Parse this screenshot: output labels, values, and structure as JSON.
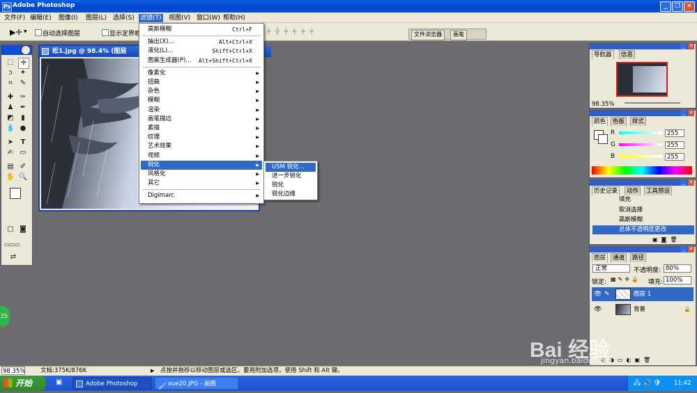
{
  "window": {
    "title": "Adobe Photoshop"
  },
  "menubar": {
    "items": [
      "文件(F)",
      "编辑(E)",
      "图像(I)",
      "图层(L)",
      "选择(S)",
      "滤镜(T)",
      "视图(V)",
      "窗口(W)",
      "帮助(H)"
    ]
  },
  "options": {
    "auto_select": "自动选择图层",
    "show_bounds": "显示定界框",
    "browser_tab": "文件浏览器",
    "brushes_tab": "画笔"
  },
  "document": {
    "title": "松1.jpg @ 98.4% (图层"
  },
  "filter_menu": {
    "items": [
      {
        "label": "高斯模糊",
        "shortcut": "Ctrl+F"
      },
      {
        "label": "抽出(X)...",
        "shortcut": "Alt+Ctrl+X"
      },
      {
        "label": "液化(L)...",
        "shortcut": "Shift+Ctrl+X"
      },
      {
        "label": "图案生成器(P)...",
        "shortcut": "Alt+Shift+Ctrl+X"
      },
      {
        "label": "像素化"
      },
      {
        "label": "扭曲"
      },
      {
        "label": "杂色"
      },
      {
        "label": "模糊"
      },
      {
        "label": "渲染"
      },
      {
        "label": "画笔描边"
      },
      {
        "label": "素描"
      },
      {
        "label": "纹理"
      },
      {
        "label": "艺术效果"
      },
      {
        "label": "视频"
      },
      {
        "label": "锐化"
      },
      {
        "label": "风格化"
      },
      {
        "label": "其它"
      },
      {
        "label": "Digimarc"
      }
    ]
  },
  "sharpen_submenu": {
    "items": [
      "USM 锐化...",
      "进一步锐化",
      "锐化",
      "锐化边缘"
    ]
  },
  "navigator": {
    "tabs": [
      "导航器",
      "信息"
    ],
    "zoom": "98.35%"
  },
  "color": {
    "tabs": [
      "颜色",
      "色板",
      "样式"
    ],
    "r_label": "R",
    "g_label": "G",
    "b_label": "B",
    "r": "255",
    "g": "255",
    "b": "255"
  },
  "history": {
    "tabs": [
      "历史记录",
      "动作",
      "工具预设"
    ],
    "items": [
      "填充",
      "取消选择",
      "高斯模糊",
      "总体不透明度更改"
    ]
  },
  "layers": {
    "tabs": [
      "图层",
      "通道",
      "路径"
    ],
    "blend": "正常",
    "opacity_label": "不透明度:",
    "opacity": "80%",
    "lock_label": "锁定:",
    "fill_label": "填充:",
    "fill": "100%",
    "items": [
      "图层 1",
      "背景"
    ]
  },
  "status": {
    "zoom": "98.35%",
    "doc": "文档:375K/876K",
    "hint": "点按并拖移以移动图层或选区。要用附加选项，使用 Shift 和 Alt 键。"
  },
  "taskbar": {
    "start": "开始",
    "tasks": [
      "Adobe Photoshop",
      "xue20.JPG - 画图"
    ],
    "clock": "11:42"
  },
  "watermark": {
    "text": "Bai 经验",
    "sub": "jingyan.baidu.com"
  }
}
